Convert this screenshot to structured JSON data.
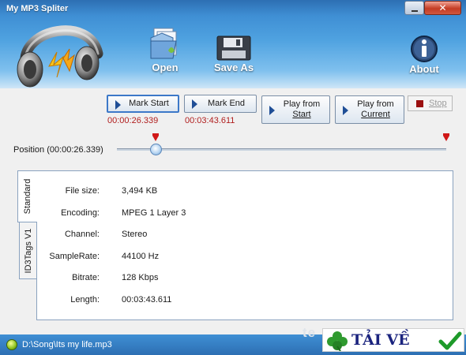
{
  "window": {
    "title": "My MP3 Spliter"
  },
  "toolbar": {
    "open_label": "Open",
    "save_as_label": "Save As",
    "about_label": "About"
  },
  "controls": {
    "mark_start_label": "Mark Start",
    "mark_end_label": "Mark End",
    "play_from_start_line1": "Play from",
    "play_from_start_line2": "Start",
    "play_from_current_line1": "Play from",
    "play_from_current_line2": "Current",
    "stop_label": "Stop",
    "mark_start_time": "00:00:26.339",
    "mark_end_time": "00:03:43.611",
    "position_label": "Position (00:00:26.339)",
    "slider_fraction": 0.118,
    "start_marker_fraction": 0.118,
    "end_marker_fraction": 1.0
  },
  "tabs": {
    "standard": "Standard",
    "id3": "ID3Tags V1"
  },
  "info": [
    {
      "label": "File size:",
      "value": "3,494 KB"
    },
    {
      "label": "Encoding:",
      "value": "MPEG 1 Layer 3"
    },
    {
      "label": "Channel:",
      "value": "Stereo"
    },
    {
      "label": "SampleRate:",
      "value": "44100 Hz"
    },
    {
      "label": "Bitrate:",
      "value": "128 Kbps"
    },
    {
      "label": "Length:",
      "value": "00:03:43.611"
    }
  ],
  "status": {
    "path": "D:\\Song\\Its my life.mp3"
  },
  "watermark": {
    "text": "te",
    "badge_text": "TẢI VỀ"
  },
  "colors": {
    "accent": "#3f8fd4",
    "time_red": "#b01e1e",
    "stop_red": "#9b1010"
  },
  "icons": {
    "app": "headphones-icon",
    "open": "folder-document-icon",
    "save_as": "floppy-disk-icon",
    "about": "info-icon",
    "status": "music-file-icon"
  }
}
